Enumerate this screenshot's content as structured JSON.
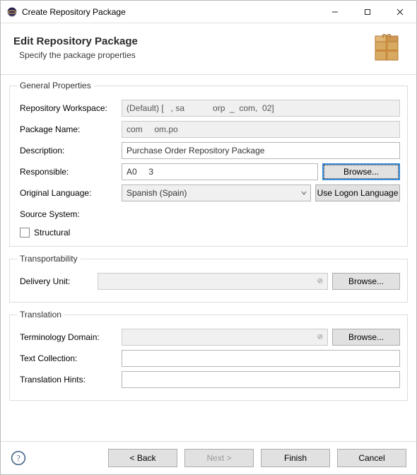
{
  "window": {
    "title": "Create Repository Package"
  },
  "header": {
    "title": "Edit Repository Package",
    "subtitle": "Specify the package properties"
  },
  "general": {
    "legend": "General Properties",
    "workspace_label": "Repository Workspace:",
    "workspace_value": "(Default) [   , sa            orp  _  com,  02]",
    "package_name_label": "Package Name:",
    "package_name_value": "com     om.po",
    "description_label": "Description:",
    "description_value": "Purchase Order Repository Package",
    "responsible_label": "Responsible:",
    "responsible_value": "A0     3",
    "browse_label": "Browse...",
    "orig_lang_label": "Original Language:",
    "orig_lang_value": "Spanish (Spain)",
    "use_logon_label": "Use Logon Language",
    "source_sys_label": "Source System:",
    "source_sys_value": "   ",
    "structural_label": "Structural"
  },
  "transport": {
    "legend": "Transportability",
    "delivery_unit_label": "Delivery Unit:",
    "delivery_unit_value": "",
    "browse_label": "Browse..."
  },
  "translation": {
    "legend": "Translation",
    "term_domain_label": "Terminology Domain:",
    "term_domain_value": "",
    "browse_label": "Browse...",
    "text_collection_label": "Text Collection:",
    "text_collection_value": "",
    "hints_label": "Translation Hints:",
    "hints_value": ""
  },
  "footer": {
    "back": "< Back",
    "next": "Next >",
    "finish": "Finish",
    "cancel": "Cancel"
  }
}
